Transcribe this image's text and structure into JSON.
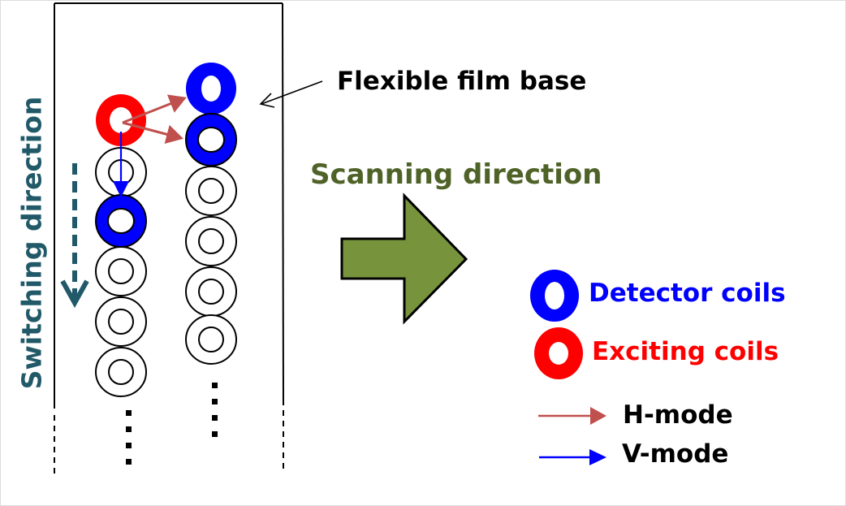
{
  "labels": {
    "film_base": "Flexible film base",
    "scanning_direction": "Scanning direction",
    "switching_direction": "Switching direction"
  },
  "legend": {
    "detector": {
      "label": "Detector coils",
      "color": "#0000ff"
    },
    "exciting": {
      "label": "Exciting coils",
      "color": "#ff0000"
    },
    "h_mode": {
      "label": "H-mode",
      "color": "#c0504d"
    },
    "v_mode": {
      "label": "V-mode",
      "color": "#0000ff"
    }
  },
  "colors": {
    "scan_arrow_fill": "#77933c",
    "scan_text": "#4f6228",
    "switch_text": "#215968"
  },
  "coil_columns": {
    "left": [
      "exciting",
      "idle",
      "detector",
      "idle",
      "idle",
      "idle"
    ],
    "right": [
      "detector",
      "detector",
      "idle",
      "idle",
      "idle",
      "idle"
    ]
  }
}
